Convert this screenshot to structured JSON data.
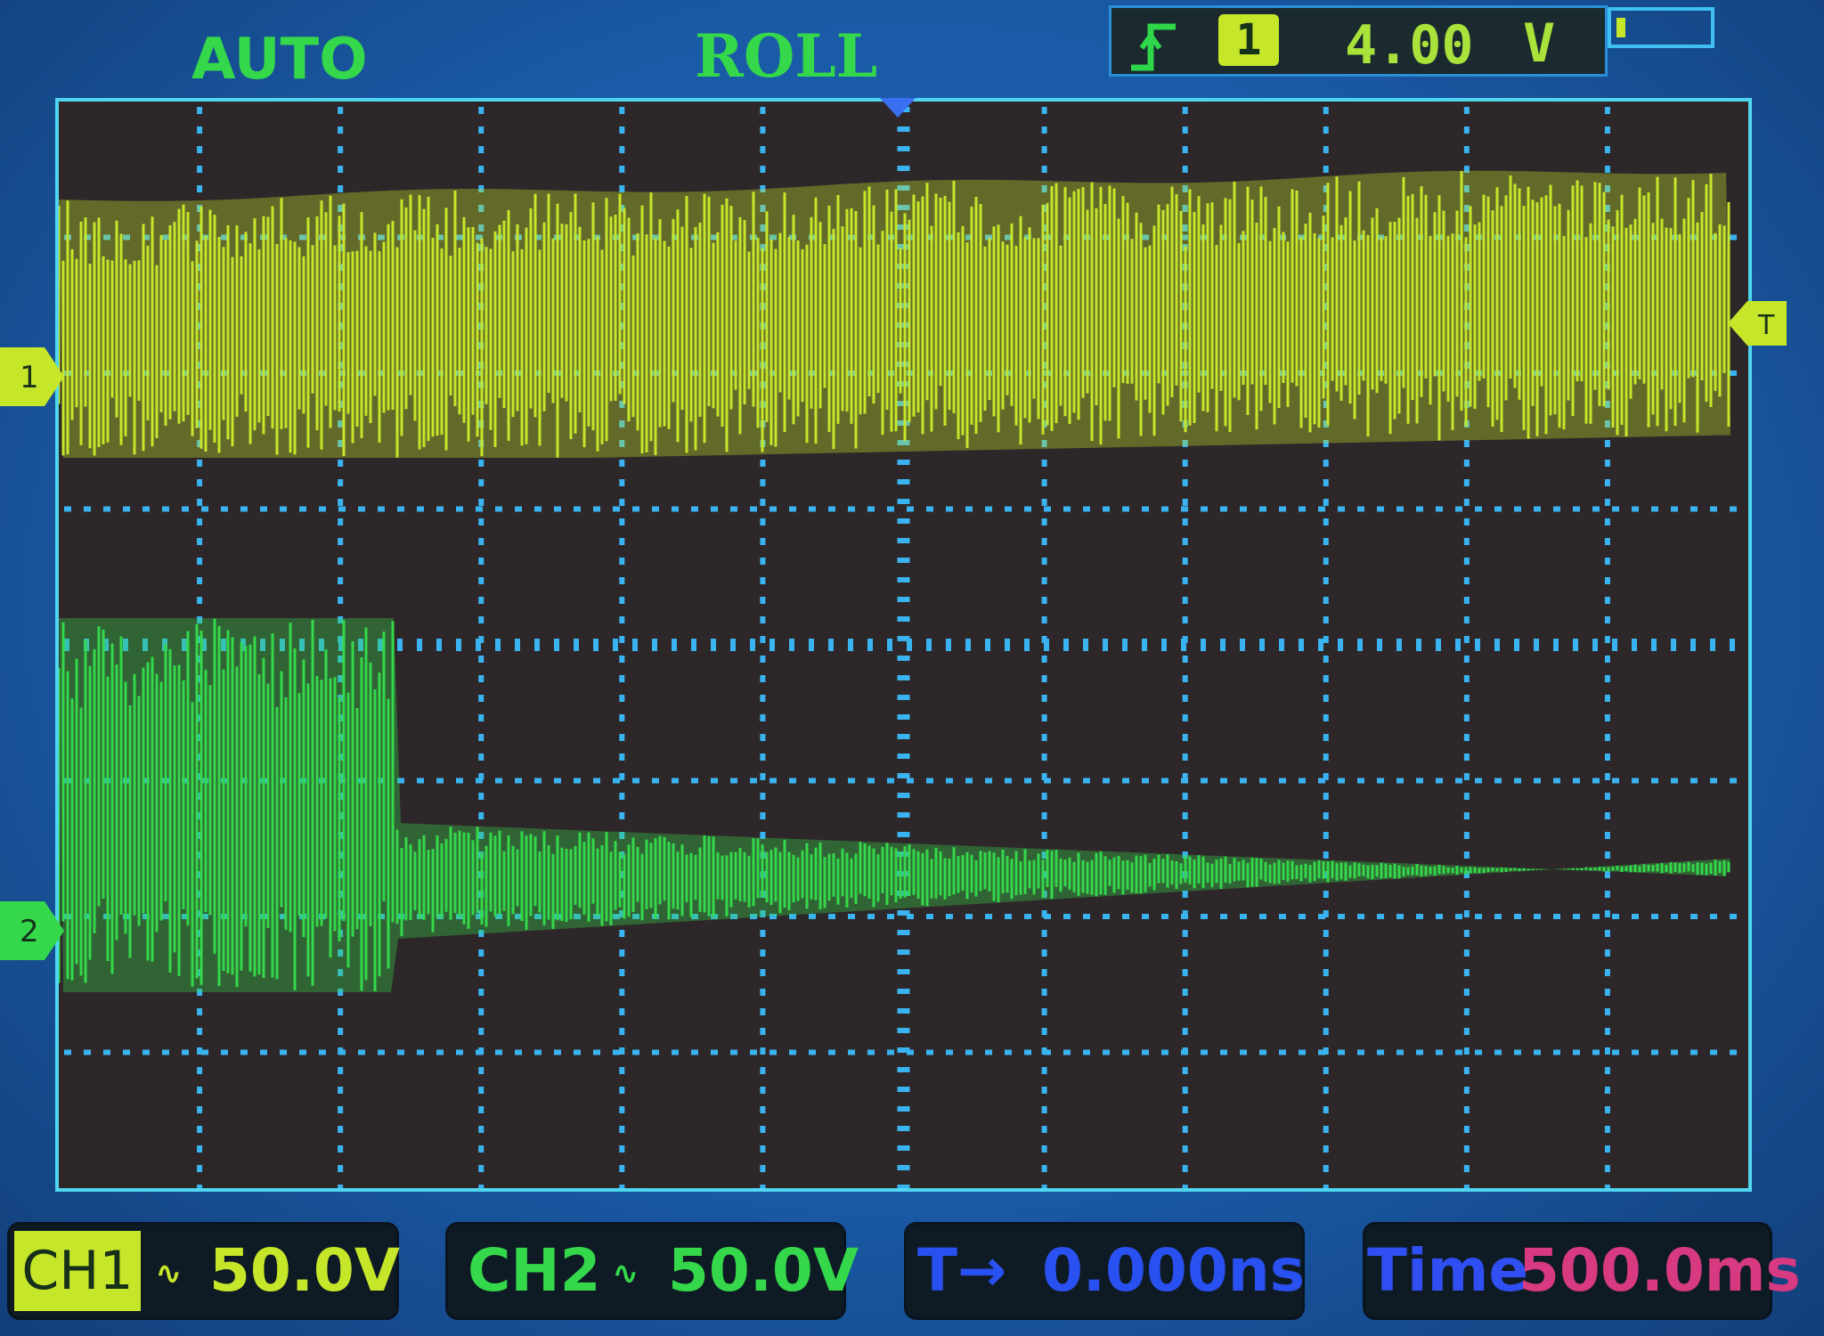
{
  "header": {
    "mode": "AUTO",
    "acquisition": "ROLL",
    "trigger_source": "1",
    "trigger_level": "4.00",
    "trigger_unit": "V",
    "trigger_edge_icon": "rising-edge-icon",
    "memory_fill_fraction": 0.1
  },
  "markers": {
    "ch1": "1",
    "ch2": "2",
    "trigger_level": "T"
  },
  "footer": {
    "ch1_label": "CH1",
    "ch1_coupling": "∿",
    "ch1_scale": "50.0V",
    "ch2_label": "CH2",
    "ch2_coupling": "∿",
    "ch2_scale": "50.0V",
    "trigger_offset_label": "T→",
    "trigger_offset": "0.000ns",
    "timebase_label": "Time",
    "timebase": "500.0ms"
  },
  "colors": {
    "ch1": "#c6e62a",
    "ch2": "#34d84a",
    "grid": "#3ab4f0",
    "screen": "#2e2729",
    "bezel": "#1a5aa6"
  }
}
